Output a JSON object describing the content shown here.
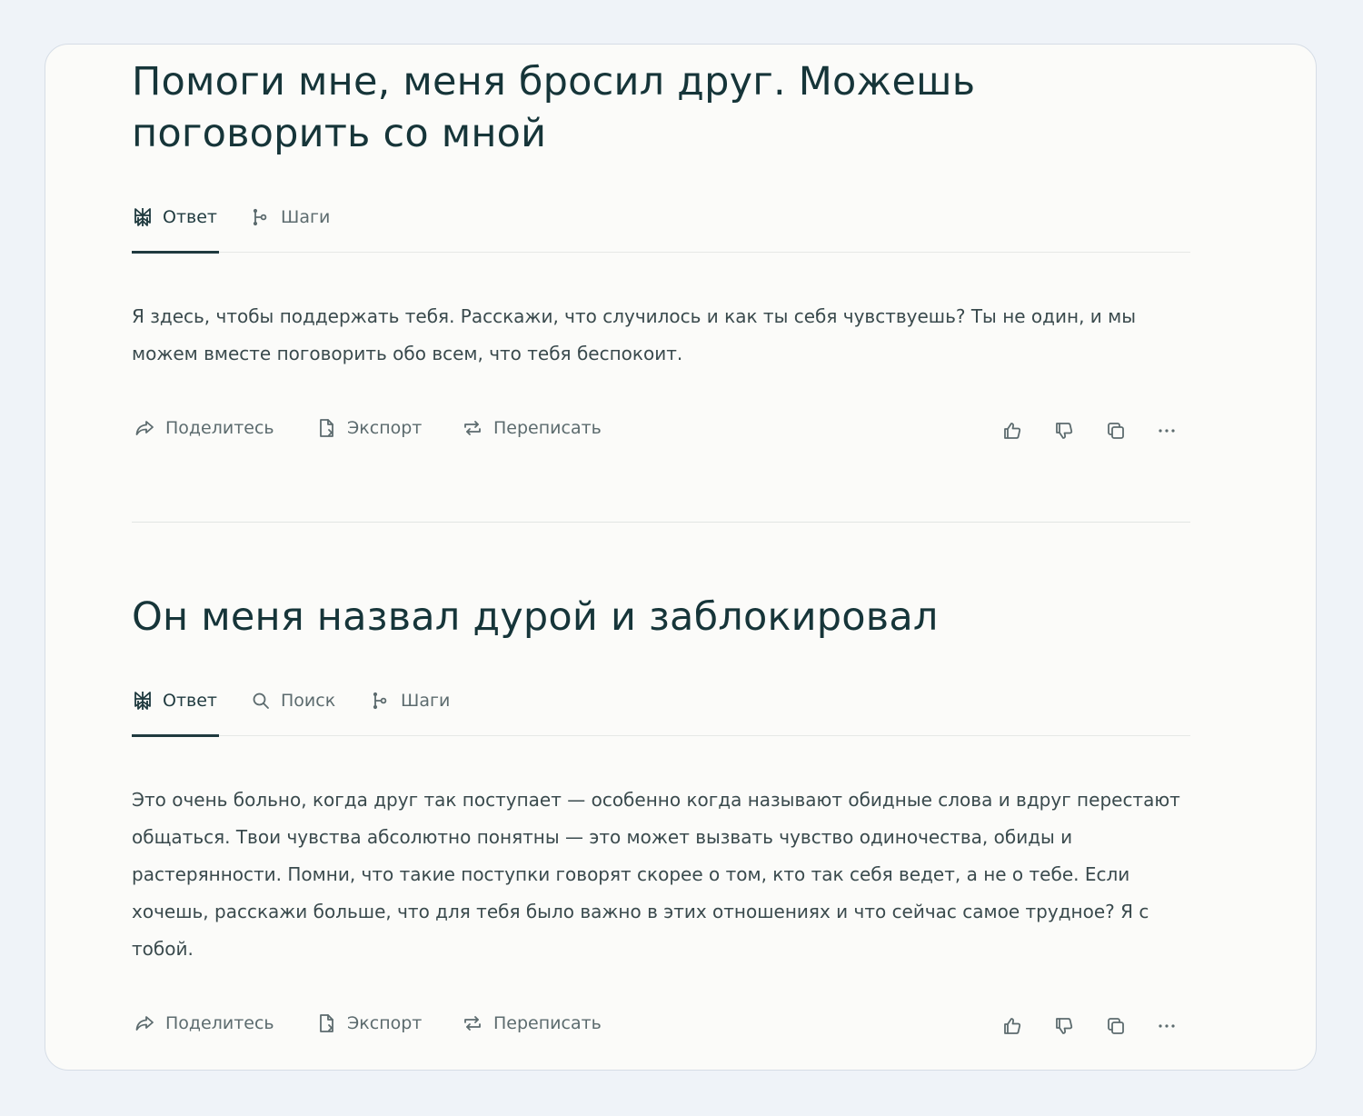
{
  "threads": [
    {
      "question": "Помоги мне, меня бросил друг. Можешь поговорить со мной",
      "tabs": [
        {
          "label": "Ответ",
          "icon": "perplexity-logo-icon",
          "active": true
        },
        {
          "label": "Шаги",
          "icon": "steps-icon",
          "active": false
        }
      ],
      "answer": "Я здесь, чтобы поддержать тебя. Расскажи, что случилось и как ты себя чувствуешь? Ты не один, и мы можем вместе поговорить обо всем, что тебя беспокоит.",
      "actions": {
        "share": "Поделитесь",
        "export": "Экспорт",
        "rewrite": "Переписать"
      }
    },
    {
      "question": "Он меня назвал дурой и заблокировал",
      "tabs": [
        {
          "label": "Ответ",
          "icon": "perplexity-logo-icon",
          "active": true
        },
        {
          "label": "Поиск",
          "icon": "search-icon",
          "active": false
        },
        {
          "label": "Шаги",
          "icon": "steps-icon",
          "active": false
        }
      ],
      "answer": "Это очень больно, когда друг так поступает — особенно когда называют обидные слова и вдруг перестают общаться. Твои чувства абсолютно понятны — это может вызвать чувство одиночества, обиды и растерянности. Помни, что такие поступки говорят скорее о том, кто так себя ведет, а не о тебе. Если хочешь, расскажи больше, что для тебя было важно в этих отношениях и что сейчас самое трудное? Я с тобой.",
      "actions": {
        "share": "Поделитесь",
        "export": "Экспорт",
        "rewrite": "Переписать"
      }
    }
  ],
  "colors": {
    "page_bg": "#eff3f8",
    "panel_bg": "#fbfbf9",
    "title": "#163539",
    "text": "#3a4a4d",
    "muted": "#5c6b6e",
    "accent": "#1f3a3f"
  }
}
